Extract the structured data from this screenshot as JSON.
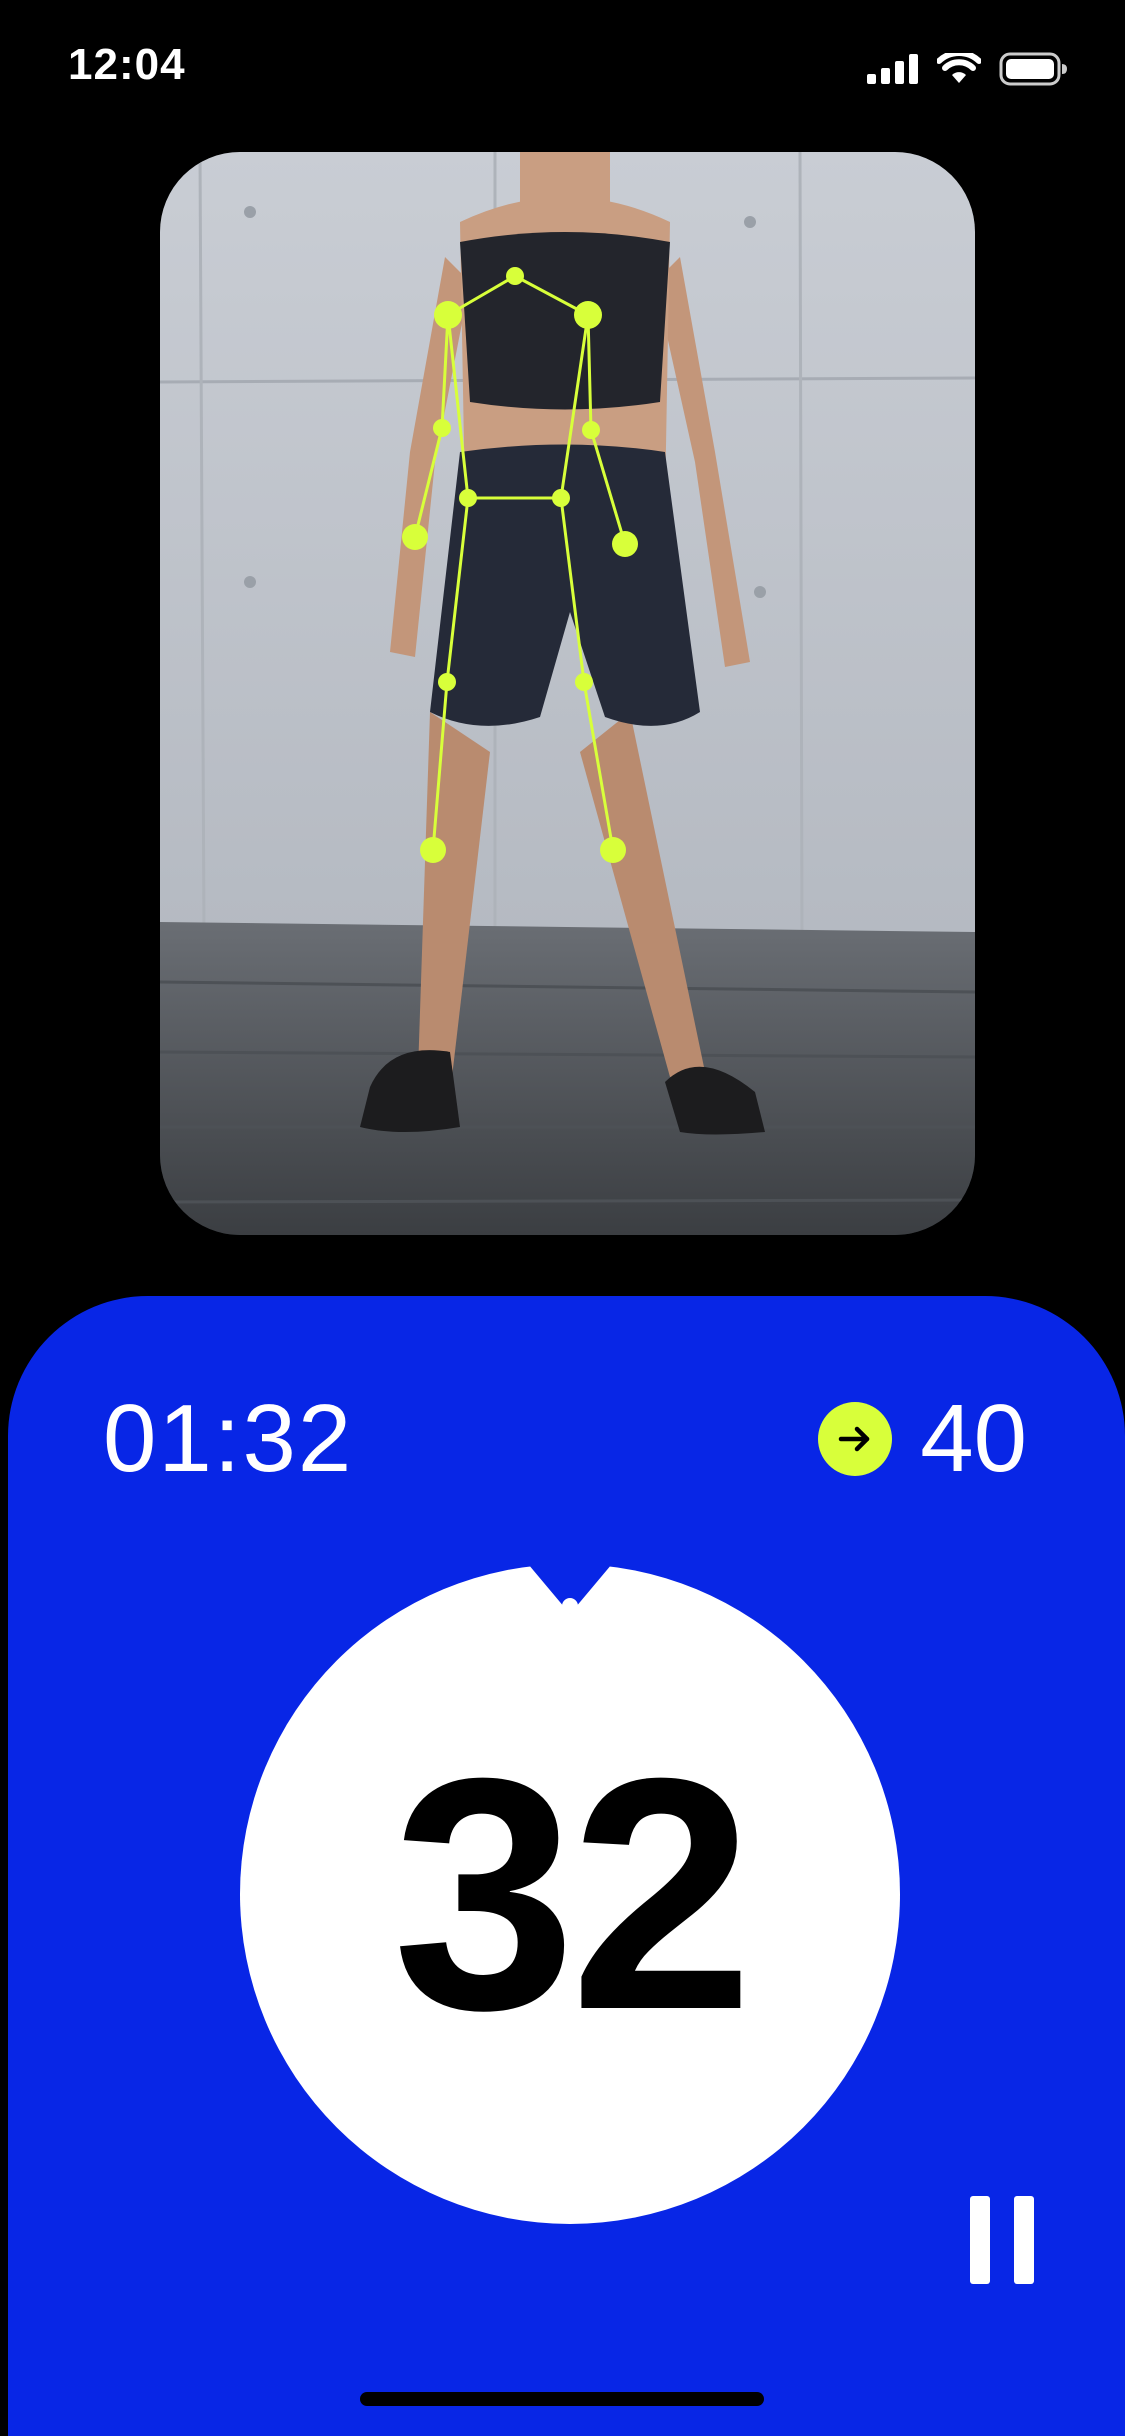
{
  "status_bar": {
    "time": "12:04",
    "icons": [
      "cellular-signal-icon",
      "wifi-icon",
      "battery-icon"
    ]
  },
  "camera_view": {
    "overlay_color": "#D8FF3A",
    "overlay": "pose-skeleton"
  },
  "workout": {
    "elapsed_time": "01:32",
    "target_reps": "40",
    "target_icon": "arrow-right-icon",
    "rep_count": "32",
    "pause_icon": "pause-icon"
  },
  "colors": {
    "panel": "#0826E6",
    "accent": "#D8FF3A",
    "background": "#000000",
    "counter_bg": "#FFFFFF"
  }
}
